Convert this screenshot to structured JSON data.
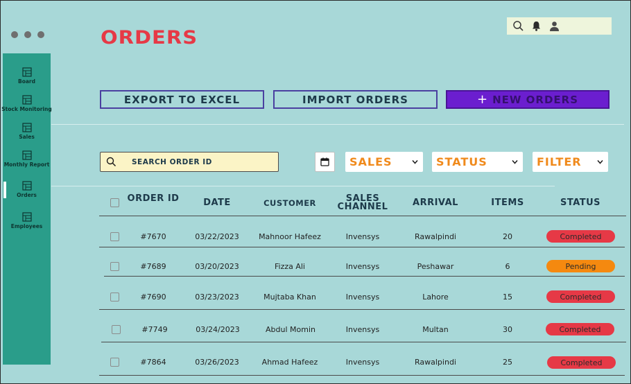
{
  "page": {
    "title": "ORDERS"
  },
  "sidebar": {
    "items": [
      {
        "label": "Board",
        "icon": "grid-icon"
      },
      {
        "label": "Stock Monitoring",
        "icon": "grid-icon"
      },
      {
        "label": "Sales",
        "icon": "grid-icon"
      },
      {
        "label": "Monthly Report",
        "icon": "grid-icon"
      },
      {
        "label": "Orders",
        "icon": "grid-icon"
      },
      {
        "label": "Employees",
        "icon": "grid-icon"
      }
    ],
    "active": "Orders"
  },
  "topbar": {
    "icons": [
      "search-icon",
      "bell-icon",
      "user-icon"
    ]
  },
  "toolbar": {
    "export_label": "EXPORT TO EXCEL",
    "import_label": "IMPORT ORDERS",
    "new_label": "NEW ORDERS",
    "new_icon": "+"
  },
  "search": {
    "placeholder": "SEARCH ORDER ID"
  },
  "filters": {
    "sales_label": "SALES",
    "status_label": "STATUS",
    "filter_label": "FILTER"
  },
  "table": {
    "headers": {
      "order_id": "ORDER ID",
      "date": "DATE",
      "customer": "CUSTOMER",
      "channel": "SALES CHANNEL",
      "arrival": "ARRIVAL",
      "items": "ITEMS",
      "status": "STATUS"
    },
    "rows": [
      {
        "order_id": "#7670",
        "date": "03/22/2023",
        "customer": "Mahnoor Hafeez",
        "channel": "Invensys",
        "arrival": "Rawalpindi",
        "items": "20",
        "status": "Completed"
      },
      {
        "order_id": "#7689",
        "date": "03/20/2023",
        "customer": "Fizza Ali",
        "channel": "Invensys",
        "arrival": "Peshawar",
        "items": "6",
        "status": "Pending"
      },
      {
        "order_id": "#7690",
        "date": "03/23/2023",
        "customer": "Mujtaba Khan",
        "channel": "Invensys",
        "arrival": "Lahore",
        "items": "15",
        "status": "Completed"
      },
      {
        "order_id": "#7749",
        "date": "03/24/2023",
        "customer": "Abdul Momin",
        "channel": "Invensys",
        "arrival": "Multan",
        "items": "30",
        "status": "Completed"
      },
      {
        "order_id": "#7864",
        "date": "03/26/2023",
        "customer": "Ahmad Hafeez",
        "channel": "Invensys",
        "arrival": "Rawalpindi",
        "items": "25",
        "status": "Completed"
      }
    ]
  },
  "colors": {
    "background": "#a8d8d8",
    "sidebar": "#2a9d8a",
    "title": "#e63946",
    "primary_button": "#6b1ecf",
    "dropdown_text": "#f08a1c",
    "completed": "#e63946",
    "pending": "#f5890f"
  }
}
